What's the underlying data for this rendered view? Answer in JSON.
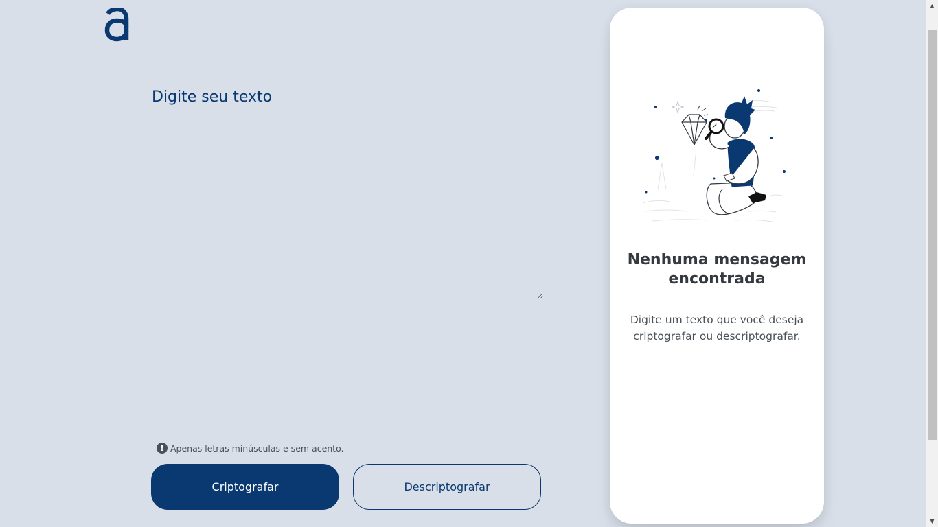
{
  "logo": {
    "icon": "alura-a-logo-icon"
  },
  "input": {
    "placeholder": "Digite seu texto",
    "value": ""
  },
  "hint": {
    "icon": "exclamation-circle-icon",
    "text": "Apenas letras minúsculas e sem acento."
  },
  "buttons": {
    "encrypt": "Criptografar",
    "decrypt": "Descriptografar"
  },
  "output": {
    "illustration": "boy-with-magnifying-glass-illustration",
    "title": "Nenhuma mensagem encontrada",
    "description": "Digite um texto que você deseja criptografar ou descriptografar."
  },
  "colors": {
    "background": "#d8dfe9",
    "primary": "#0a3871",
    "panel": "#ffffff",
    "title": "#343a40",
    "text": "#495057"
  }
}
